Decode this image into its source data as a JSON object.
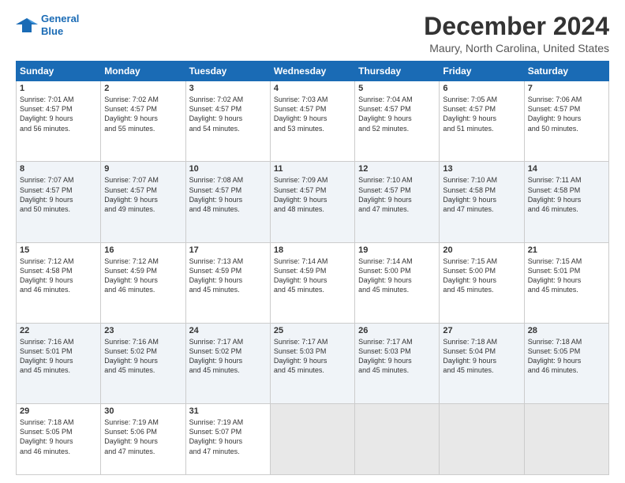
{
  "header": {
    "logo_line1": "General",
    "logo_line2": "Blue",
    "main_title": "December 2024",
    "subtitle": "Maury, North Carolina, United States"
  },
  "days_of_week": [
    "Sunday",
    "Monday",
    "Tuesday",
    "Wednesday",
    "Thursday",
    "Friday",
    "Saturday"
  ],
  "weeks": [
    [
      {
        "day": "1",
        "info": "Sunrise: 7:01 AM\nSunset: 4:57 PM\nDaylight: 9 hours\nand 56 minutes."
      },
      {
        "day": "2",
        "info": "Sunrise: 7:02 AM\nSunset: 4:57 PM\nDaylight: 9 hours\nand 55 minutes."
      },
      {
        "day": "3",
        "info": "Sunrise: 7:02 AM\nSunset: 4:57 PM\nDaylight: 9 hours\nand 54 minutes."
      },
      {
        "day": "4",
        "info": "Sunrise: 7:03 AM\nSunset: 4:57 PM\nDaylight: 9 hours\nand 53 minutes."
      },
      {
        "day": "5",
        "info": "Sunrise: 7:04 AM\nSunset: 4:57 PM\nDaylight: 9 hours\nand 52 minutes."
      },
      {
        "day": "6",
        "info": "Sunrise: 7:05 AM\nSunset: 4:57 PM\nDaylight: 9 hours\nand 51 minutes."
      },
      {
        "day": "7",
        "info": "Sunrise: 7:06 AM\nSunset: 4:57 PM\nDaylight: 9 hours\nand 50 minutes."
      }
    ],
    [
      {
        "day": "8",
        "info": "Sunrise: 7:07 AM\nSunset: 4:57 PM\nDaylight: 9 hours\nand 50 minutes."
      },
      {
        "day": "9",
        "info": "Sunrise: 7:07 AM\nSunset: 4:57 PM\nDaylight: 9 hours\nand 49 minutes."
      },
      {
        "day": "10",
        "info": "Sunrise: 7:08 AM\nSunset: 4:57 PM\nDaylight: 9 hours\nand 48 minutes."
      },
      {
        "day": "11",
        "info": "Sunrise: 7:09 AM\nSunset: 4:57 PM\nDaylight: 9 hours\nand 48 minutes."
      },
      {
        "day": "12",
        "info": "Sunrise: 7:10 AM\nSunset: 4:57 PM\nDaylight: 9 hours\nand 47 minutes."
      },
      {
        "day": "13",
        "info": "Sunrise: 7:10 AM\nSunset: 4:58 PM\nDaylight: 9 hours\nand 47 minutes."
      },
      {
        "day": "14",
        "info": "Sunrise: 7:11 AM\nSunset: 4:58 PM\nDaylight: 9 hours\nand 46 minutes."
      }
    ],
    [
      {
        "day": "15",
        "info": "Sunrise: 7:12 AM\nSunset: 4:58 PM\nDaylight: 9 hours\nand 46 minutes."
      },
      {
        "day": "16",
        "info": "Sunrise: 7:12 AM\nSunset: 4:59 PM\nDaylight: 9 hours\nand 46 minutes."
      },
      {
        "day": "17",
        "info": "Sunrise: 7:13 AM\nSunset: 4:59 PM\nDaylight: 9 hours\nand 45 minutes."
      },
      {
        "day": "18",
        "info": "Sunrise: 7:14 AM\nSunset: 4:59 PM\nDaylight: 9 hours\nand 45 minutes."
      },
      {
        "day": "19",
        "info": "Sunrise: 7:14 AM\nSunset: 5:00 PM\nDaylight: 9 hours\nand 45 minutes."
      },
      {
        "day": "20",
        "info": "Sunrise: 7:15 AM\nSunset: 5:00 PM\nDaylight: 9 hours\nand 45 minutes."
      },
      {
        "day": "21",
        "info": "Sunrise: 7:15 AM\nSunset: 5:01 PM\nDaylight: 9 hours\nand 45 minutes."
      }
    ],
    [
      {
        "day": "22",
        "info": "Sunrise: 7:16 AM\nSunset: 5:01 PM\nDaylight: 9 hours\nand 45 minutes."
      },
      {
        "day": "23",
        "info": "Sunrise: 7:16 AM\nSunset: 5:02 PM\nDaylight: 9 hours\nand 45 minutes."
      },
      {
        "day": "24",
        "info": "Sunrise: 7:17 AM\nSunset: 5:02 PM\nDaylight: 9 hours\nand 45 minutes."
      },
      {
        "day": "25",
        "info": "Sunrise: 7:17 AM\nSunset: 5:03 PM\nDaylight: 9 hours\nand 45 minutes."
      },
      {
        "day": "26",
        "info": "Sunrise: 7:17 AM\nSunset: 5:03 PM\nDaylight: 9 hours\nand 45 minutes."
      },
      {
        "day": "27",
        "info": "Sunrise: 7:18 AM\nSunset: 5:04 PM\nDaylight: 9 hours\nand 45 minutes."
      },
      {
        "day": "28",
        "info": "Sunrise: 7:18 AM\nSunset: 5:05 PM\nDaylight: 9 hours\nand 46 minutes."
      }
    ],
    [
      {
        "day": "29",
        "info": "Sunrise: 7:18 AM\nSunset: 5:05 PM\nDaylight: 9 hours\nand 46 minutes."
      },
      {
        "day": "30",
        "info": "Sunrise: 7:19 AM\nSunset: 5:06 PM\nDaylight: 9 hours\nand 47 minutes."
      },
      {
        "day": "31",
        "info": "Sunrise: 7:19 AM\nSunset: 5:07 PM\nDaylight: 9 hours\nand 47 minutes."
      },
      null,
      null,
      null,
      null
    ]
  ]
}
